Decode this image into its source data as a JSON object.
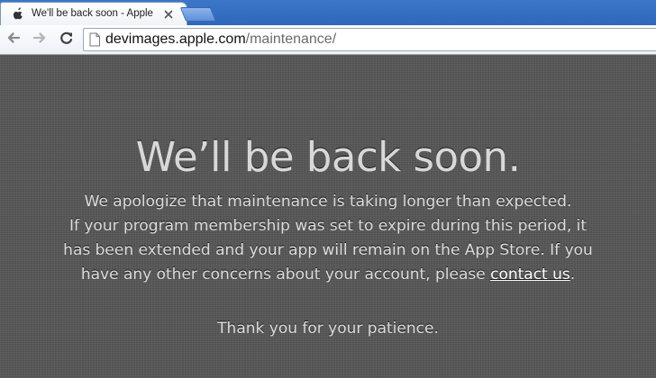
{
  "browser": {
    "tab": {
      "title": "We'll be back soon - Apple De"
    },
    "address_bar": {
      "url_host": "devimages.apple.com",
      "url_path": "/maintenance/"
    }
  },
  "page": {
    "headline": "We’ll be back soon.",
    "message_lines": [
      "We apologize that maintenance is taking longer than expected.",
      "If your program membership was set to expire during this period, it",
      "has been extended and your app will remain on the App Store. If you"
    ],
    "message_last_prefix": "have any other concerns about your account, please ",
    "contact_link_text": "contact us",
    "message_last_suffix": ".",
    "thanks": "Thank you for your patience."
  },
  "icons": {
    "tab_favicon": "apple-icon",
    "tab_close": "close-icon",
    "back": "back-arrow-icon",
    "forward": "forward-arrow-icon",
    "reload": "reload-icon",
    "page": "page-icon"
  }
}
